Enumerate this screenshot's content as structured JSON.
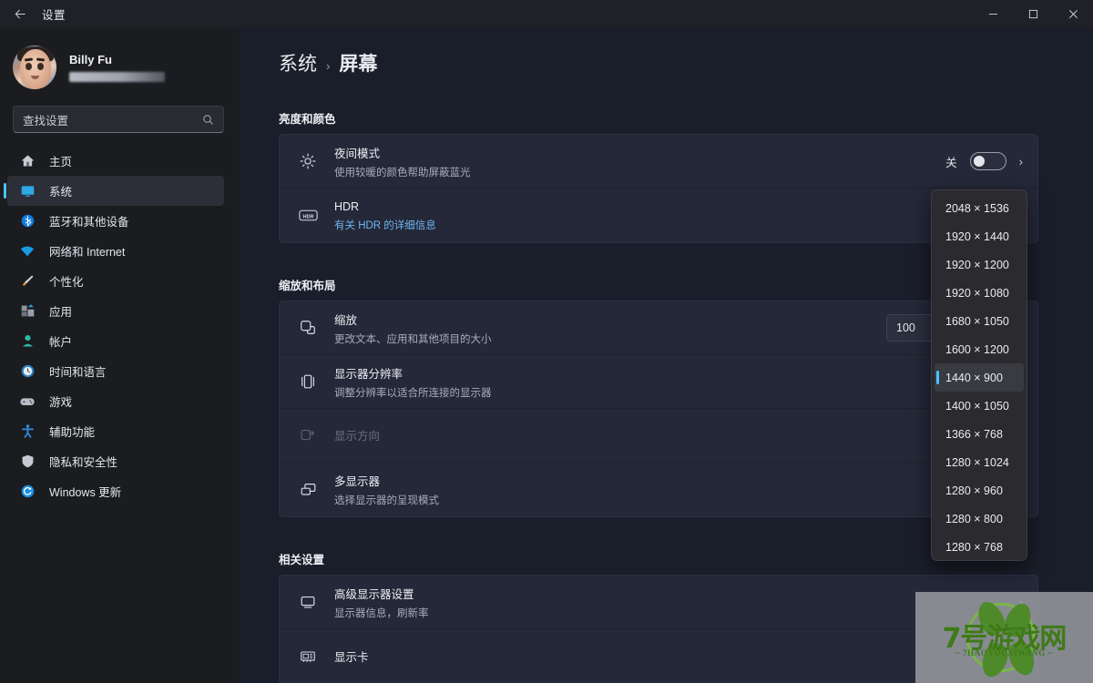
{
  "window": {
    "title": "设置",
    "back_icon": "arrow-left-icon",
    "minimize_label": "—",
    "maximize_label": "▢",
    "close_label": "✕"
  },
  "sidebar": {
    "profile": {
      "name": "Billy Fu",
      "email_masked": ""
    },
    "search": {
      "placeholder": "查找设置",
      "icon": "search-icon"
    },
    "items": [
      {
        "label": "主页",
        "icon": "home-icon",
        "active": false
      },
      {
        "label": "系统",
        "icon": "system-display-icon",
        "active": true
      },
      {
        "label": "蓝牙和其他设备",
        "icon": "bluetooth-icon",
        "active": false
      },
      {
        "label": "网络和 Internet",
        "icon": "wifi-icon",
        "active": false
      },
      {
        "label": "个性化",
        "icon": "paintbrush-icon",
        "active": false
      },
      {
        "label": "应用",
        "icon": "apps-icon",
        "active": false
      },
      {
        "label": "帐户",
        "icon": "account-icon",
        "active": false
      },
      {
        "label": "时间和语言",
        "icon": "clock-icon",
        "active": false
      },
      {
        "label": "游戏",
        "icon": "gamepad-icon",
        "active": false
      },
      {
        "label": "辅助功能",
        "icon": "accessibility-icon",
        "active": false
      },
      {
        "label": "隐私和安全性",
        "icon": "shield-icon",
        "active": false
      },
      {
        "label": "Windows 更新",
        "icon": "update-icon",
        "active": false
      }
    ]
  },
  "main": {
    "breadcrumb": {
      "parent": "系统",
      "separator": "›",
      "current": "屏幕"
    },
    "sections": [
      {
        "title": "亮度和颜色",
        "rows": [
          {
            "icon": "brightness-sun-icon",
            "title": "夜间模式",
            "subtitle": "使用较暖的颜色帮助屏蔽蓝光",
            "subtitle_is_link": false,
            "toggle_label": "关",
            "toggle_on": false,
            "chevron": "›",
            "disabled": false
          },
          {
            "icon": "hdr-badge-icon",
            "title": "HDR",
            "subtitle": "有关 HDR 的详细信息",
            "subtitle_is_link": true,
            "disabled": false
          }
        ]
      },
      {
        "title": "缩放和布局",
        "rows": [
          {
            "icon": "scale-icon",
            "title": "缩放",
            "subtitle": "更改文本、应用和其他项目的大小",
            "subtitle_is_link": false,
            "combo_value": "100",
            "disabled": false
          },
          {
            "icon": "resolution-icon",
            "title": "显示器分辨率",
            "subtitle": "调整分辨率以适合所连接的显示器",
            "subtitle_is_link": false,
            "disabled": false
          },
          {
            "icon": "orientation-icon",
            "title": "显示方向",
            "subtitle": "",
            "subtitle_is_link": false,
            "disabled": true
          },
          {
            "icon": "multi-display-icon",
            "title": "多显示器",
            "subtitle": "选择显示器的呈现模式",
            "subtitle_is_link": false,
            "disabled": false
          }
        ]
      },
      {
        "title": "相关设置",
        "rows": [
          {
            "icon": "monitor-icon",
            "title": "高级显示器设置",
            "subtitle": "显示器信息，刷新率",
            "subtitle_is_link": false,
            "chevron": "›",
            "disabled": false
          },
          {
            "icon": "graphics-card-icon",
            "title": "显示卡",
            "subtitle": "",
            "subtitle_is_link": false,
            "disabled": false
          }
        ]
      }
    ]
  },
  "resolution_dropdown": {
    "selected": "1440 × 900",
    "options": [
      "2048 × 1536",
      "1920 × 1440",
      "1920 × 1200",
      "1920 × 1080",
      "1680 × 1050",
      "1600 × 1200",
      "1440 × 900",
      "1400 × 1050",
      "1366 × 768",
      "1280 × 1024",
      "1280 × 960",
      "1280 × 800",
      "1280 × 768"
    ]
  },
  "watermark": {
    "text": "7号游戏网",
    "subtext": "~ 7HAOYOUXIWANG ~"
  },
  "colors": {
    "accent": "#4cc2ff",
    "page_bg": "#1a1e2a",
    "sidebar_bg": "#1b1c20",
    "card_bg": "#242838",
    "link": "#6fb6f0"
  }
}
